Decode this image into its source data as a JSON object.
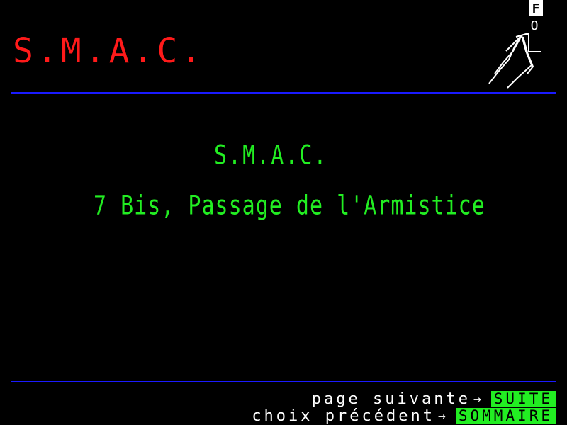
{
  "screen": {
    "background_color": "#000000",
    "accent_colors": {
      "title_red": "#ff1a1a",
      "rule_blue": "#1a1aff",
      "text_green": "#22ee22",
      "text_white": "#ffffff"
    }
  },
  "header": {
    "title": "S.M.A.C.",
    "logo": {
      "icon": "fo-running-man-icon",
      "letter_top": "F",
      "letter_bottom": "O"
    }
  },
  "main": {
    "title": "S.M.A.C.",
    "address": "7 Bis, Passage de l'Armistice"
  },
  "footer": {
    "next": {
      "label": "page suivante",
      "arrow": "→",
      "key": "SUITE"
    },
    "previous": {
      "label": "choix précédent",
      "arrow": "→",
      "key": "SOMMAIRE"
    }
  }
}
